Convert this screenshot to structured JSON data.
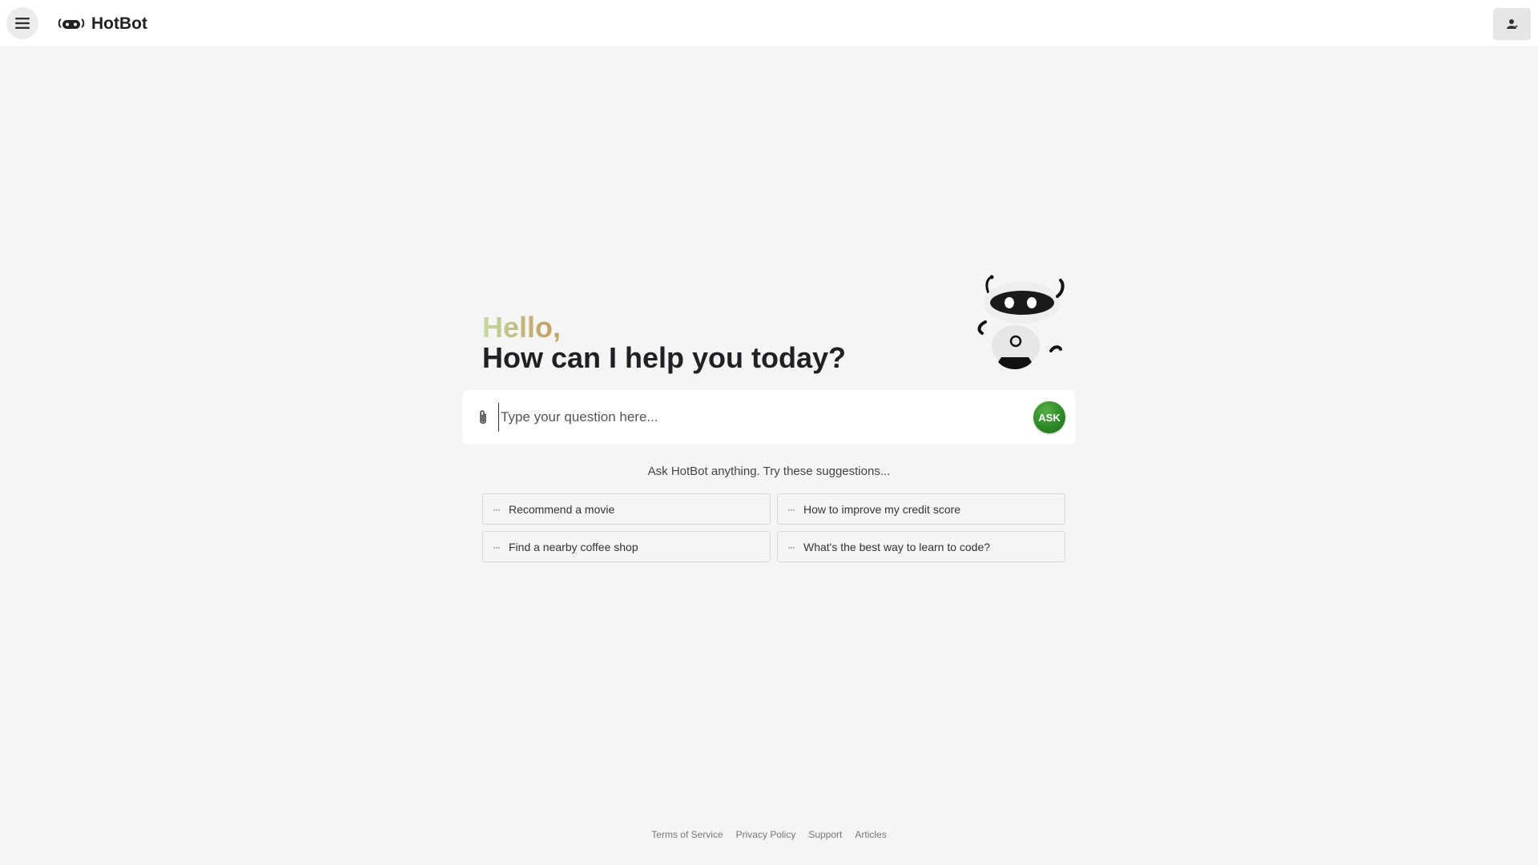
{
  "header": {
    "app_name": "HotBot"
  },
  "hero": {
    "greeting": "Hello,",
    "headline": "How can I help you today?"
  },
  "ask": {
    "placeholder": "Type your question here...",
    "button_label": "ASK"
  },
  "suggestions": {
    "title": "Ask HotBot anything. Try these suggestions...",
    "items": [
      {
        "label": "Recommend a movie"
      },
      {
        "label": "How to improve my credit score"
      },
      {
        "label": "Find a nearby coffee shop"
      },
      {
        "label": "What's the best way to learn to code?"
      }
    ]
  },
  "footer": {
    "links": [
      "Terms of Service",
      "Privacy Policy",
      "Support",
      "Articles"
    ]
  },
  "colors": {
    "accent_green": "#2d8a26",
    "background": "#f5f5f5",
    "greeting_gradient_start": "#c5d9a2",
    "greeting_gradient_end": "#c3a466"
  }
}
